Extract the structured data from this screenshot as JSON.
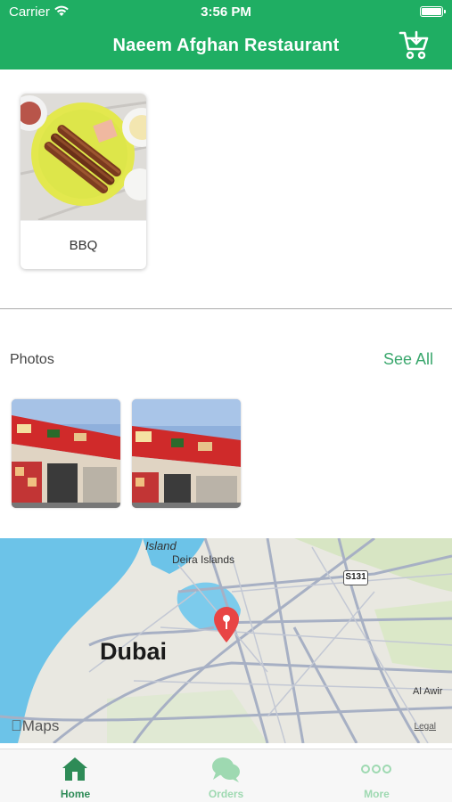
{
  "status_bar": {
    "carrier": "Carrier",
    "time": "3:56 PM"
  },
  "header": {
    "title": "Naeem Afghan Restaurant",
    "cart_icon": "cart-icon",
    "background": "#1fae63"
  },
  "categories": [
    {
      "label": "BBQ"
    }
  ],
  "photos": {
    "title": "Photos",
    "see_all": "See All",
    "count": 2
  },
  "map": {
    "labels": {
      "island": "Island",
      "deira": "Deira Islands",
      "city": "Dubai",
      "awir": "Al Awir"
    },
    "road_shield": "S131",
    "attribution": "Maps",
    "legal": "Legal",
    "pin_color": "#e84545"
  },
  "tab_bar": {
    "tabs": [
      {
        "label": "Home",
        "icon": "home-icon"
      },
      {
        "label": "Orders",
        "icon": "chat-bubbles-icon"
      },
      {
        "label": "More",
        "icon": "more-dots-icon"
      }
    ],
    "active_color": "#2e8b57",
    "inactive_color": "#9ed9b1"
  }
}
